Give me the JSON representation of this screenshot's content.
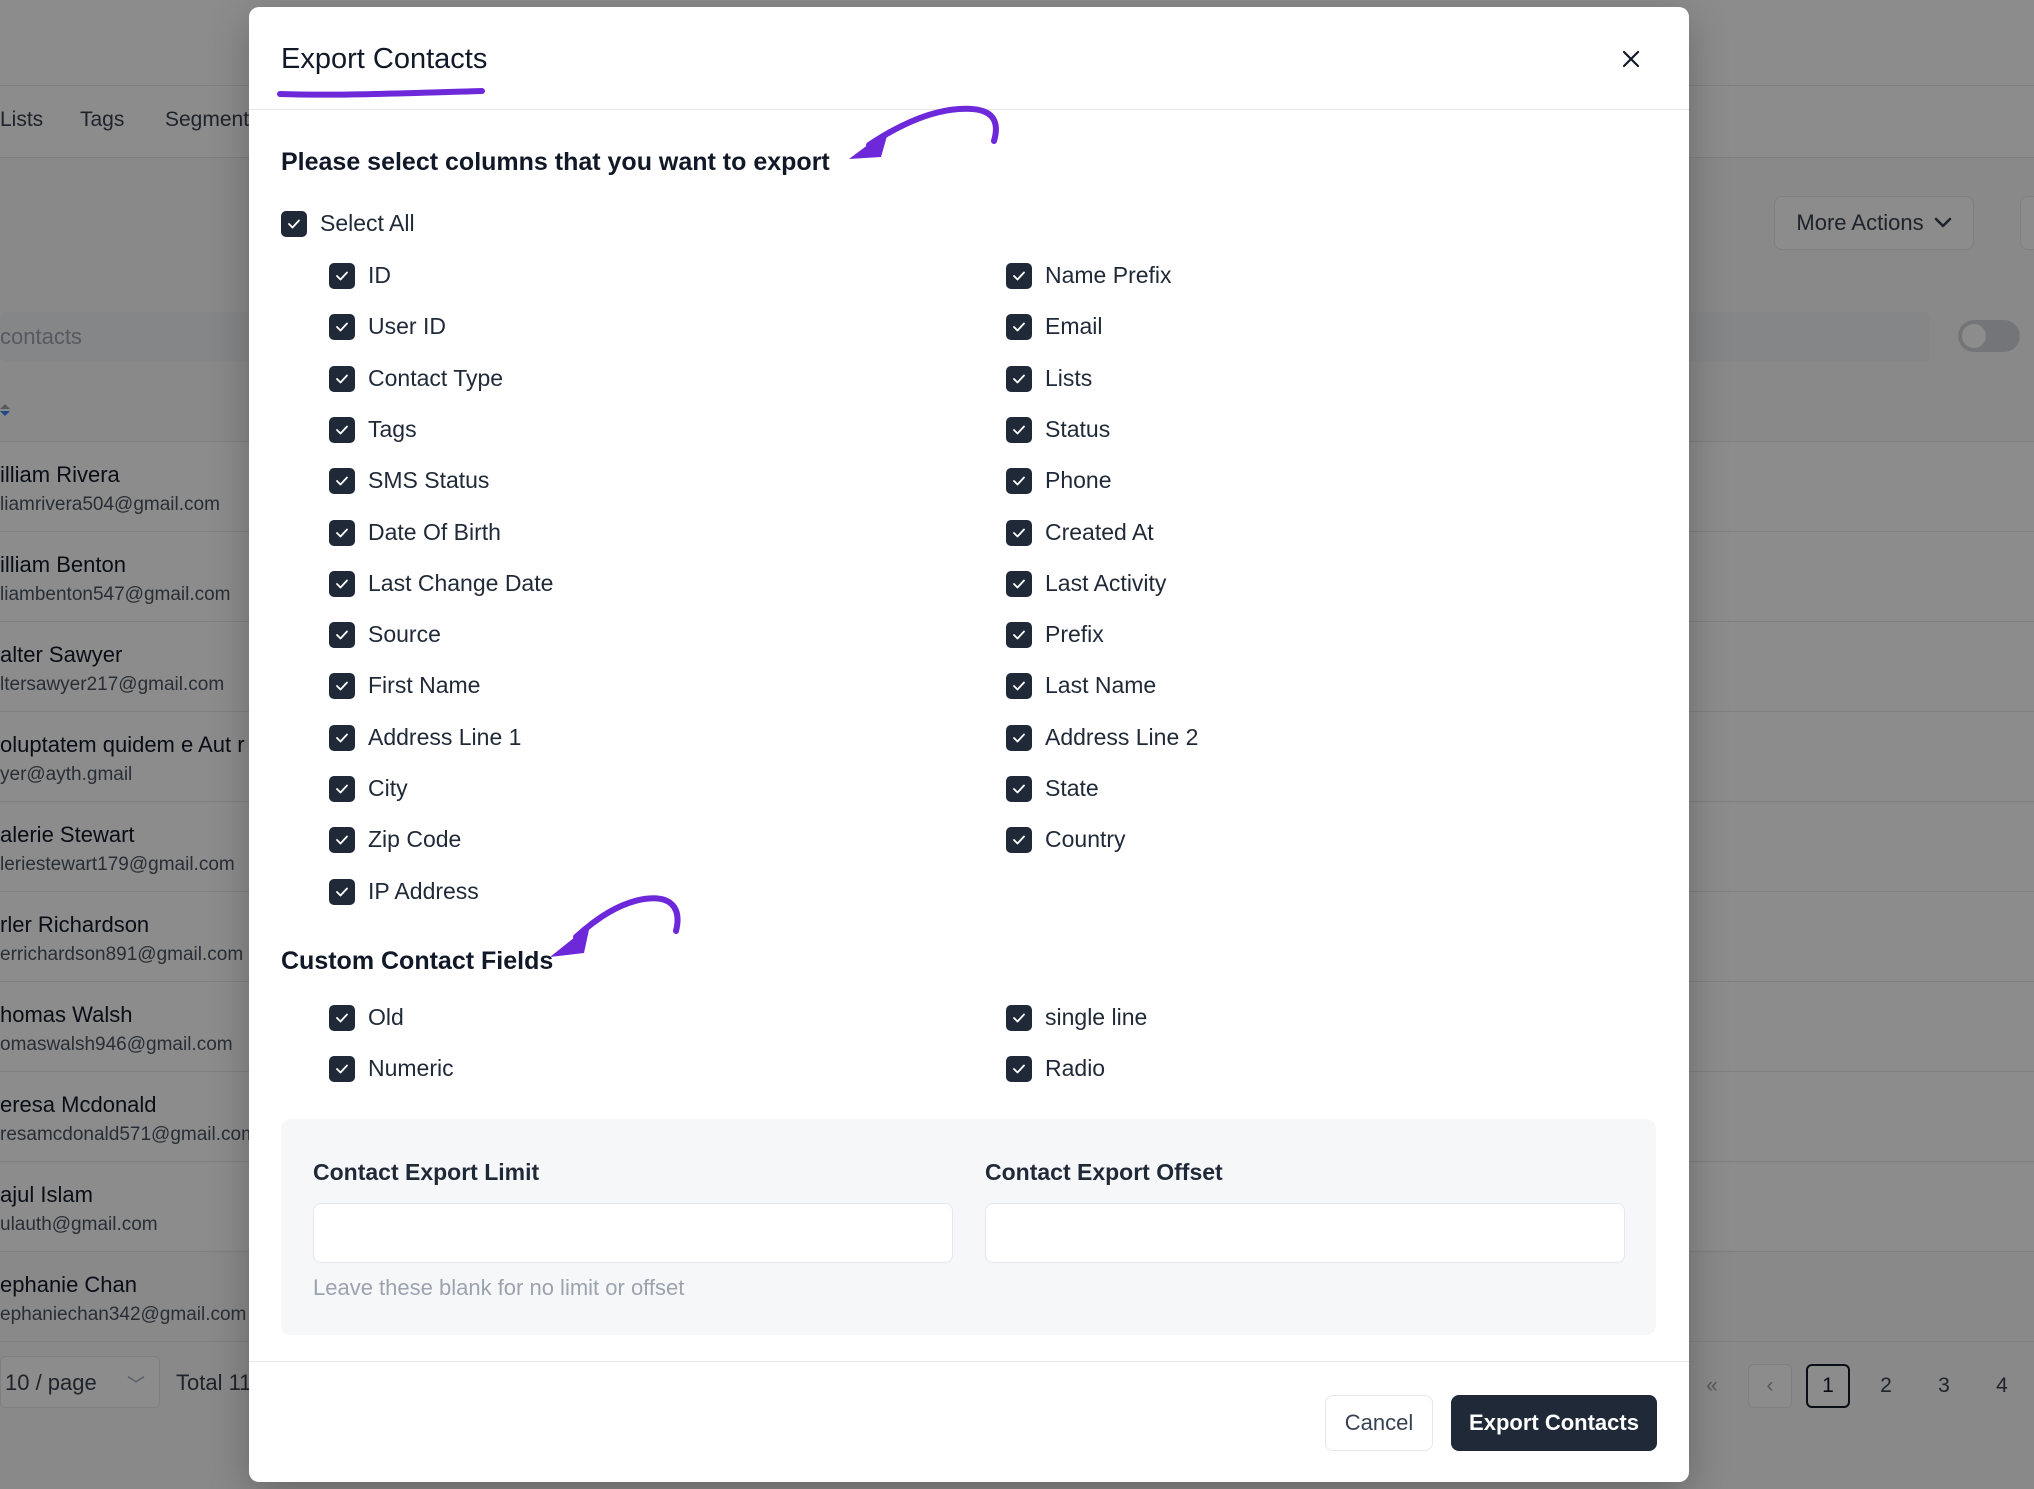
{
  "background": {
    "tabs": [
      "Lists",
      "Tags",
      "Segment"
    ],
    "more_actions_label": "More Actions",
    "search_placeholder": "contacts",
    "rows": [
      {
        "name": "illiam Rivera",
        "email": "liamrivera504@gmail.com"
      },
      {
        "name": "illiam Benton",
        "email": "liambenton547@gmail.com"
      },
      {
        "name": "alter Sawyer",
        "email": "ltersawyer217@gmail.com"
      },
      {
        "name": "oluptatem quidem e Aut r",
        "email": "yer@ayth.gmail"
      },
      {
        "name": "alerie Stewart",
        "email": "leriestewart179@gmail.com"
      },
      {
        "name": "rler Richardson",
        "email": "errichardson891@gmail.com"
      },
      {
        "name": "homas Walsh",
        "email": "omaswalsh946@gmail.com"
      },
      {
        "name": "eresa Mcdonald",
        "email": "resamcdonald571@gmail.com"
      },
      {
        "name": "ajul Islam",
        "email": "ulauth@gmail.com"
      },
      {
        "name": "ephanie Chan",
        "email": "ephaniechan342@gmail.com"
      }
    ],
    "per_page": "10 / page",
    "total": "Total 11",
    "pages": [
      "1",
      "2",
      "3",
      "4"
    ]
  },
  "modal": {
    "title": "Export Contacts",
    "columns_heading": "Please select columns that you want to export",
    "select_all_label": "Select All",
    "columns_left": [
      "ID",
      "User ID",
      "Contact Type",
      "Tags",
      "SMS Status",
      "Date Of Birth",
      "Last Change Date",
      "Source",
      "First Name",
      "Address Line 1",
      "City",
      "Zip Code",
      "IP Address"
    ],
    "columns_right": [
      "Name Prefix",
      "Email",
      "Lists",
      "Status",
      "Phone",
      "Created At",
      "Last Activity",
      "Prefix",
      "Last Name",
      "Address Line 2",
      "State",
      "Country"
    ],
    "custom_heading": "Custom Contact Fields",
    "custom_left": [
      "Old",
      "Numeric"
    ],
    "custom_right": [
      "single line",
      "Radio"
    ],
    "limit_label": "Contact Export Limit",
    "offset_label": "Contact Export Offset",
    "limit_value": "",
    "offset_value": "",
    "help_text": "Leave these blank for no limit or offset",
    "cancel_label": "Cancel",
    "export_label": "Export Contacts"
  },
  "colors": {
    "annotation": "#6d28d9",
    "checkbox": "#1f2937",
    "primary_button": "#1f2937"
  },
  "icons": [
    "close-icon",
    "checkmark-icon",
    "chevron-down-icon",
    "double-chevron-left-icon",
    "chevron-left-icon",
    "annotation-arrow-icon"
  ]
}
